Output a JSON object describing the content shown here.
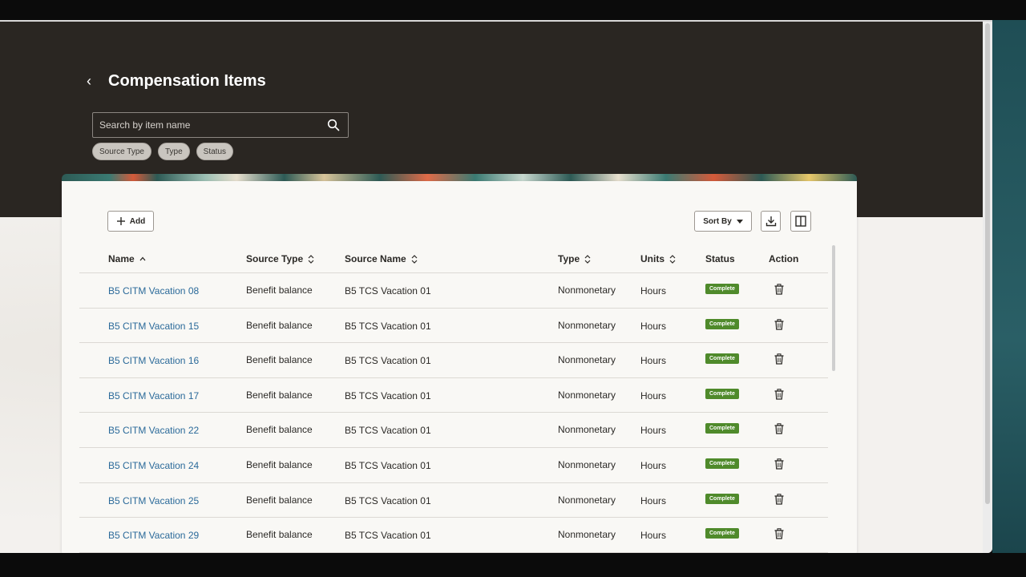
{
  "page": {
    "title": "Compensation Items",
    "back_label": "‹"
  },
  "search": {
    "placeholder": "Search by item name",
    "value": ""
  },
  "filters": [
    "Source Type",
    "Type",
    "Status"
  ],
  "toolbar": {
    "add_label": "Add",
    "sort_label": "Sort By"
  },
  "table": {
    "columns": [
      "Name",
      "Source Type",
      "Source Name",
      "Type",
      "Units",
      "Status",
      "Action"
    ],
    "rows": [
      {
        "name": "B5 CITM Vacation 08",
        "source_type": "Benefit balance",
        "source_name": "B5 TCS Vacation 01",
        "type": "Nonmonetary",
        "units": "Hours",
        "status": "Complete"
      },
      {
        "name": "B5 CITM Vacation 15",
        "source_type": "Benefit balance",
        "source_name": "B5 TCS Vacation 01",
        "type": "Nonmonetary",
        "units": "Hours",
        "status": "Complete"
      },
      {
        "name": "B5 CITM Vacation 16",
        "source_type": "Benefit balance",
        "source_name": "B5 TCS Vacation 01",
        "type": "Nonmonetary",
        "units": "Hours",
        "status": "Complete"
      },
      {
        "name": "B5 CITM Vacation 17",
        "source_type": "Benefit balance",
        "source_name": "B5 TCS Vacation 01",
        "type": "Nonmonetary",
        "units": "Hours",
        "status": "Complete"
      },
      {
        "name": "B5 CITM Vacation 22",
        "source_type": "Benefit balance",
        "source_name": "B5 TCS Vacation 01",
        "type": "Nonmonetary",
        "units": "Hours",
        "status": "Complete"
      },
      {
        "name": "B5 CITM Vacation 24",
        "source_type": "Benefit balance",
        "source_name": "B5 TCS Vacation 01",
        "type": "Nonmonetary",
        "units": "Hours",
        "status": "Complete"
      },
      {
        "name": "B5 CITM Vacation 25",
        "source_type": "Benefit balance",
        "source_name": "B5 TCS Vacation 01",
        "type": "Nonmonetary",
        "units": "Hours",
        "status": "Complete"
      },
      {
        "name": "B5 CITM Vacation 29",
        "source_type": "Benefit balance",
        "source_name": "B5 TCS Vacation 01",
        "type": "Nonmonetary",
        "units": "Hours",
        "status": "Complete"
      }
    ]
  },
  "colors": {
    "header_bg": "#2a2622",
    "link": "#2b6a9a",
    "status_complete": "#4f8a2b"
  },
  "icons": [
    "back-chevron-icon",
    "search-icon",
    "plus-icon",
    "caret-down-icon",
    "download-icon",
    "columns-icon",
    "sort-asc-icon",
    "sort-icon",
    "trash-icon"
  ]
}
